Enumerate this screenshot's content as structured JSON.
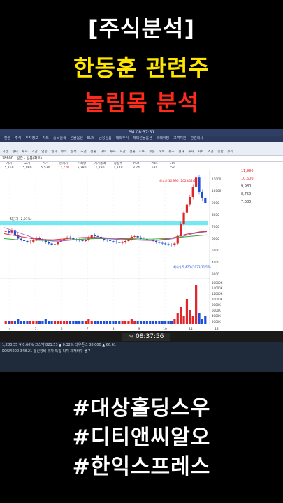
{
  "headlines": {
    "line1": "[주식분석]",
    "line2": "한동훈 관련주",
    "line3": "눌림목 분석"
  },
  "hashtags": [
    "#대상홀딩스우",
    "#디티앤씨알오",
    "#한익스프레스"
  ],
  "screen": {
    "window_title": "PM 08:37:51",
    "menu": [
      "환경",
      "주식",
      "투자정보",
      "차트",
      "종목검색",
      "선물옵션",
      "ELW",
      "금융상품",
      "해외주식",
      "해외선물옵션",
      "트레이딩",
      "고객지원",
      "관련회사"
    ],
    "toolbar_buttons": [
      "시간",
      "현재",
      "투자",
      "기간",
      "업종",
      "일자",
      "주식",
      "분석",
      "조건",
      "선물",
      "차트",
      "투자",
      "시간",
      "선물",
      "ETF",
      "주문",
      "해외",
      "뉴스",
      "현재",
      "투자",
      "차트",
      "조건",
      "종합",
      "주식"
    ],
    "subbar_text": "38600 · 일간 · 일봉(차트)",
    "quote_labels": [
      "시가",
      "고가",
      "저가",
      "현재가",
      "거래량",
      "시가총액",
      "상장주",
      "PER",
      "PBR",
      "EPS"
    ],
    "quote_values": [
      "5,750",
      "5,880",
      "5,530",
      "12,720",
      "5,280",
      "1,730",
      "1,170",
      "3.74",
      "581",
      "52"
    ],
    "high_label": "최고가 10,990 (2023/12/11)",
    "low_label": "최저가 5,470 (2023/11/16)",
    "band_label": "최근가 (2,01%)",
    "x_ticks": [
      "4",
      "5",
      "6",
      "7",
      "8",
      "9",
      "10",
      "11",
      "12"
    ],
    "y_ticks": [
      "11000",
      "10000",
      "9000",
      "8000",
      "7000",
      "6000",
      "5000",
      "4000",
      "3000"
    ],
    "vol_ticks": [
      "16000K",
      "14000K",
      "12000K",
      "10000K",
      "8000K",
      "6000K",
      "4000K",
      "2000K"
    ],
    "right_values": [
      "11,990",
      "10,500",
      "9,980",
      "8,750",
      "7,680"
    ],
    "clock_prefix": "PM",
    "clock_time": "08:37:56",
    "taskbar_line1": "1,283.35  ▼ 0.60%    코스닥 821.53  ▲ 0.32%    다우존스 38,000  ▲ 66.61",
    "taskbar_line2": "KOSPI200  348.21    통신장비 투자  특집-디지  제재바꾸 불구",
    "accent_up": "#e0262a",
    "accent_down": "#1f4fd6",
    "band_color": "#5fe3f0"
  },
  "chart_data": {
    "type": "candlestick",
    "x": [
      "4",
      "5",
      "6",
      "7",
      "8",
      "9",
      "10",
      "11",
      "12"
    ],
    "ylim": [
      3000,
      11000
    ],
    "high": {
      "value": 10990,
      "date": "2023/12/11"
    },
    "low": {
      "value": 5470,
      "date": "2023/11/16"
    },
    "close_series": [
      6600,
      6500,
      6700,
      6300,
      6000,
      5900,
      5800,
      5700,
      5750,
      5900,
      6050,
      5950,
      5850,
      5700,
      5600,
      5500,
      5550,
      5700,
      5850,
      6000,
      6100,
      6050,
      5950,
      5900,
      5850,
      5800,
      5900,
      6100,
      6300,
      6200,
      6150,
      6000,
      5900,
      5850,
      5800,
      5750,
      5700,
      5650,
      5700,
      5800,
      5950,
      6150,
      6200,
      6100,
      6000,
      5950,
      5900,
      5850,
      5800,
      5700,
      5650,
      5600,
      5550,
      5500,
      5470,
      5600,
      6200,
      7200,
      8100,
      8800,
      9400,
      10200,
      10990,
      9800,
      9300,
      8900
    ],
    "ma_green": [
      6000,
      5950,
      5900,
      5880,
      5870,
      5860,
      5850,
      5860,
      5880,
      5900,
      5920,
      5950,
      5980,
      6000,
      6020,
      6030,
      6040,
      6020,
      6000,
      5980,
      5970,
      5960,
      5980,
      6000,
      6050,
      6100,
      6150,
      6200,
      6250,
      6300
    ],
    "ma_red": [
      6400,
      6300,
      6200,
      6100,
      6000,
      5950,
      5920,
      5900,
      5950,
      6000,
      6050,
      6080,
      6100,
      6100,
      6080,
      6050,
      6020,
      5980,
      5950,
      5900,
      5880,
      5860,
      5880,
      5950,
      6050,
      6200,
      6350,
      6450,
      6550,
      6600
    ],
    "ma_purple": [
      6900,
      6700,
      6500,
      6300,
      6100,
      5950,
      5850,
      5800,
      5800,
      5850,
      5900,
      5950,
      5980,
      6000,
      6000,
      5980,
      5950,
      5920,
      5900,
      5880,
      5860,
      5850,
      5860,
      5900,
      5980,
      6100,
      6250,
      6400,
      6500,
      6560
    ],
    "volume": [
      1,
      1,
      1,
      1,
      2,
      1,
      1,
      1,
      1,
      1,
      1,
      1,
      1,
      2,
      1,
      1,
      1,
      1,
      1,
      1,
      1,
      1,
      1,
      1,
      1,
      1,
      1,
      2,
      1,
      1,
      1,
      1,
      1,
      1,
      1,
      1,
      1,
      1,
      1,
      1,
      1,
      2,
      1,
      1,
      1,
      1,
      1,
      1,
      1,
      1,
      1,
      1,
      1,
      1,
      1,
      2,
      4,
      6,
      3,
      9,
      5,
      3,
      14,
      4,
      2,
      3
    ],
    "support_band": [
      7100,
      7400
    ]
  }
}
